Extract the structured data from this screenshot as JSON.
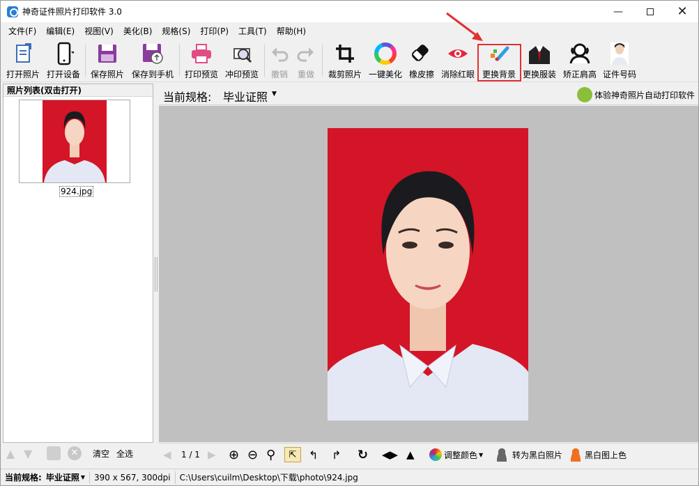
{
  "window": {
    "title": "神奇证件照片打印软件 3.0"
  },
  "menu": [
    "文件(F)",
    "编辑(E)",
    "视图(V)",
    "美化(B)",
    "规格(S)",
    "打印(P)",
    "工具(T)",
    "帮助(H)"
  ],
  "toolbar": {
    "open_photo": "打开照片",
    "open_device": "打开设备",
    "save_photo": "保存照片",
    "save_to_phone": "保存到手机",
    "print_preview": "打印预览",
    "develop_preview": "冲印预览",
    "undo": "撤销",
    "redo": "重做",
    "crop": "裁剪照片",
    "one_click_beautify": "一键美化",
    "eraser": "橡皮擦",
    "remove_red_eye": "消除红眼",
    "change_background": "更换背景",
    "change_clothes": "更换服装",
    "correct_shoulders": "矫正肩高",
    "id_number": "证件号码"
  },
  "left_panel": {
    "title": "照片列表(双击打开)",
    "files": [
      "924.jpg"
    ],
    "clear": "清空",
    "select_all": "全选"
  },
  "right_header": {
    "spec_label": "当前规格:",
    "spec_value": "毕业证照",
    "try_app": "体验神奇照片自动打印软件"
  },
  "bottom": {
    "page": "1 / 1",
    "adjust_color": "调整颜色",
    "to_bw": "转为黑白照片",
    "colorize": "黑白图上色"
  },
  "status": {
    "spec_label": "当前规格:",
    "spec_value": "毕业证照",
    "size": "390 x 567, 300dpi",
    "path": "C:\\Users\\cuilm\\Desktop\\下载\\photo\\924.jpg"
  },
  "colors": {
    "photo_bg": "#d31527",
    "highlight": "#e03030",
    "shirt": "#e4e8f4"
  }
}
